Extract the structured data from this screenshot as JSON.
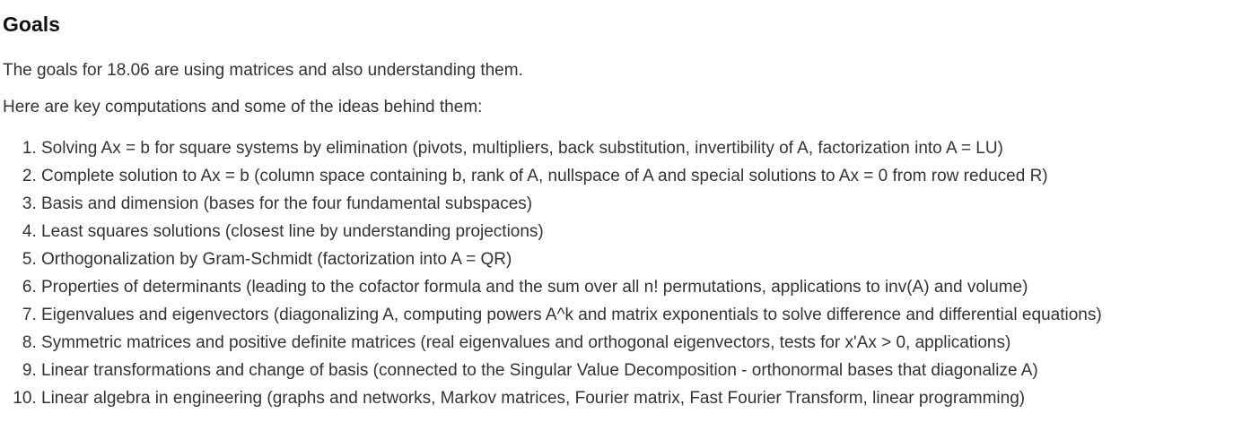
{
  "heading": "Goals",
  "intro": "The goals for 18.06 are using matrices and also understanding them.",
  "lead": "Here are key computations and some of the ideas behind them:",
  "items": [
    "Solving Ax = b for square systems by elimination (pivots, multipliers, back substitution, invertibility of A, factorization into A = LU)",
    "Complete solution to Ax = b (column space containing b, rank of A, nullspace of A and special solutions to Ax = 0 from row reduced R)",
    "Basis and dimension (bases for the four fundamental subspaces)",
    "Least squares solutions (closest line by understanding projections)",
    "Orthogonalization by Gram-Schmidt (factorization into A = QR)",
    "Properties of determinants (leading to the cofactor formula and the sum over all n! permutations, applications to inv(A) and volume)",
    "Eigenvalues and eigenvectors (diagonalizing A, computing powers A^k and matrix exponentials to solve difference and differential equations)",
    "Symmetric matrices and positive definite matrices (real eigenvalues and orthogonal eigenvectors, tests for x'Ax > 0, applications)",
    "Linear transformations and change of basis (connected to the Singular Value Decomposition - orthonormal bases that diagonalize A)",
    "Linear algebra in engineering (graphs and networks, Markov matrices, Fourier matrix, Fast Fourier Transform, linear programming)"
  ]
}
